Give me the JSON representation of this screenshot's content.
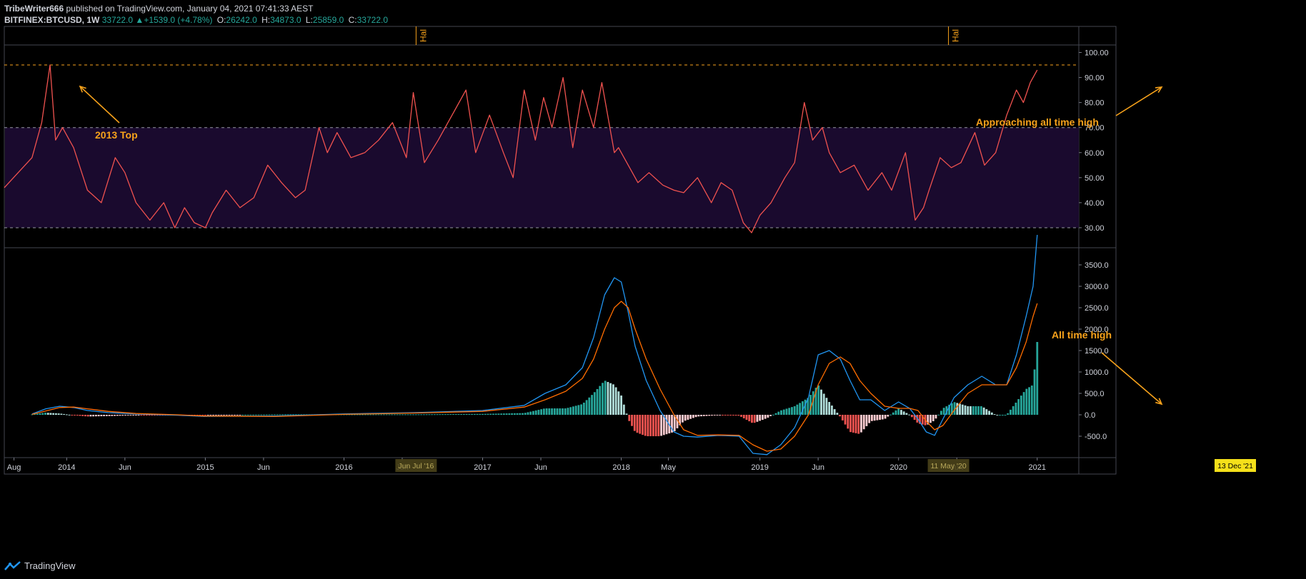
{
  "header": {
    "author": "TribeWriter666",
    "published_text": "published on TradingView.com, January 04, 2021 07:41:33 AEST",
    "symbol": "BITFINEX:BTCUSD, 1W",
    "last": "33722.0",
    "change": "+1539.0 (+4.78%)",
    "open_label": "O:",
    "open": "26242.0",
    "high_label": "H:",
    "high": "34873.0",
    "low_label": "L:",
    "low": "25859.0",
    "close_label": "C:",
    "close": "33722.0"
  },
  "brand": {
    "name": "TradingView"
  },
  "colors": {
    "background": "#000000",
    "rsi_line": "#f0524f",
    "rsi_band": "#1a0a2e",
    "annotation": "#f7a21b",
    "macd_line": "#2196f3",
    "signal_line": "#ff6d00",
    "hist_up_strong": "#26a69a",
    "hist_up_weak": "#b2dfdb",
    "hist_down_strong": "#ef5350",
    "hist_down_weak": "#ffcdd2",
    "date_badge": "#f5e01a"
  },
  "events": {
    "halving_label": "Hal",
    "halvings": [
      {
        "date": "2016.52"
      },
      {
        "date": "2020.36"
      }
    ]
  },
  "x_axis": {
    "range": [
      2013.55,
      2021.3
    ],
    "ticks": [
      {
        "t": 2013.62,
        "label": "Aug"
      },
      {
        "t": 2014.0,
        "label": "2014"
      },
      {
        "t": 2014.42,
        "label": "Jun"
      },
      {
        "t": 2015.0,
        "label": "2015"
      },
      {
        "t": 2015.42,
        "label": "Jun"
      },
      {
        "t": 2016.0,
        "label": "2016"
      },
      {
        "t": 2016.42,
        "label": "Jun"
      },
      {
        "t": 2017.0,
        "label": "2017"
      },
      {
        "t": 2017.42,
        "label": "Jun"
      },
      {
        "t": 2018.0,
        "label": "2018"
      },
      {
        "t": 2018.34,
        "label": "May"
      },
      {
        "t": 2019.0,
        "label": "2019"
      },
      {
        "t": 2019.42,
        "label": "Jun"
      },
      {
        "t": 2020.0,
        "label": "2020"
      },
      {
        "t": 2020.42,
        "label": "Jun"
      },
      {
        "t": 2021.0,
        "label": "2021"
      }
    ],
    "markers": [
      {
        "t": 2016.52,
        "label": "Jun Jul '16"
      },
      {
        "t": 2020.36,
        "label": "11 May '20"
      }
    ],
    "cursor_label": "13 Dec '21"
  },
  "chart_data": [
    {
      "type": "line",
      "name": "RSI",
      "ylim": [
        22,
        103
      ],
      "yticks": [
        30,
        40,
        50,
        60,
        70,
        80,
        90,
        100
      ],
      "ytick_labels": [
        "30.00",
        "40.00",
        "50.00",
        "60.00",
        "70.00",
        "80.00",
        "90.00",
        "100.00"
      ],
      "levels": {
        "oversold": 30,
        "overbought": 70,
        "prior_top": 95
      },
      "x": [
        2013.55,
        2013.65,
        2013.75,
        2013.82,
        2013.88,
        2013.92,
        2013.97,
        2014.05,
        2014.15,
        2014.25,
        2014.35,
        2014.42,
        2014.5,
        2014.6,
        2014.7,
        2014.78,
        2014.85,
        2014.92,
        2015.0,
        2015.05,
        2015.15,
        2015.25,
        2015.35,
        2015.45,
        2015.55,
        2015.65,
        2015.72,
        2015.82,
        2015.88,
        2015.95,
        2016.05,
        2016.15,
        2016.25,
        2016.35,
        2016.45,
        2016.5,
        2016.58,
        2016.68,
        2016.78,
        2016.88,
        2016.95,
        2017.05,
        2017.15,
        2017.22,
        2017.3,
        2017.38,
        2017.44,
        2017.5,
        2017.58,
        2017.65,
        2017.72,
        2017.8,
        2017.86,
        2017.95,
        2017.98,
        2018.05,
        2018.12,
        2018.2,
        2018.3,
        2018.38,
        2018.45,
        2018.55,
        2018.65,
        2018.72,
        2018.8,
        2018.88,
        2018.94,
        2019.0,
        2019.08,
        2019.18,
        2019.25,
        2019.32,
        2019.38,
        2019.45,
        2019.5,
        2019.58,
        2019.68,
        2019.78,
        2019.88,
        2019.95,
        2020.05,
        2020.12,
        2020.18,
        2020.22,
        2020.3,
        2020.38,
        2020.45,
        2020.55,
        2020.62,
        2020.7,
        2020.78,
        2020.85,
        2020.9,
        2020.95,
        2021.0
      ],
      "y": [
        46,
        52,
        58,
        72,
        95,
        65,
        70,
        62,
        45,
        40,
        58,
        52,
        40,
        33,
        40,
        30,
        38,
        32,
        30,
        36,
        45,
        38,
        42,
        55,
        48,
        42,
        45,
        70,
        60,
        68,
        58,
        60,
        65,
        72,
        58,
        84,
        56,
        65,
        75,
        85,
        60,
        75,
        60,
        50,
        85,
        65,
        82,
        70,
        90,
        62,
        85,
        70,
        88,
        60,
        62,
        55,
        48,
        52,
        47,
        45,
        44,
        50,
        40,
        48,
        45,
        32,
        28,
        35,
        40,
        50,
        56,
        80,
        65,
        70,
        60,
        52,
        55,
        45,
        52,
        45,
        60,
        33,
        38,
        45,
        58,
        54,
        56,
        68,
        55,
        60,
        75,
        85,
        80,
        88,
        93
      ]
    },
    {
      "type": "line",
      "name": "MACD",
      "ylim": [
        -1000,
        3900
      ],
      "yticks": [
        -500,
        0,
        500,
        1000,
        1500,
        2000,
        2500,
        3000,
        3500
      ],
      "ytick_labels": [
        "-500.0",
        "0.0",
        "500.0",
        "1000.0",
        "1500.0",
        "2000.0",
        "2500.0",
        "3000.0",
        "3500.0"
      ],
      "x": [
        2013.75,
        2013.85,
        2013.95,
        2014.05,
        2014.15,
        2014.3,
        2014.5,
        2014.8,
        2015.0,
        2015.5,
        2016.0,
        2016.5,
        2017.0,
        2017.3,
        2017.45,
        2017.6,
        2017.72,
        2017.8,
        2017.88,
        2017.95,
        2018.0,
        2018.05,
        2018.1,
        2018.18,
        2018.28,
        2018.38,
        2018.45,
        2018.55,
        2018.7,
        2018.85,
        2018.95,
        2019.05,
        2019.15,
        2019.25,
        2019.35,
        2019.42,
        2019.5,
        2019.58,
        2019.65,
        2019.72,
        2019.8,
        2019.9,
        2020.0,
        2020.08,
        2020.14,
        2020.2,
        2020.26,
        2020.32,
        2020.4,
        2020.5,
        2020.6,
        2020.7,
        2020.78,
        2020.85,
        2020.92,
        2020.97,
        2021.0
      ],
      "series": [
        {
          "name": "MACD",
          "values": [
            20,
            140,
            200,
            170,
            100,
            50,
            20,
            -10,
            -40,
            -30,
            20,
            50,
            100,
            220,
            500,
            700,
            1100,
            1800,
            2800,
            3200,
            3100,
            2400,
            1600,
            800,
            100,
            -400,
            -500,
            -520,
            -480,
            -500,
            -900,
            -930,
            -700,
            -300,
            400,
            1400,
            1500,
            1300,
            800,
            350,
            350,
            100,
            300,
            150,
            -100,
            -400,
            -480,
            -100,
            400,
            700,
            900,
            700,
            700,
            1400,
            2300,
            3000,
            4200
          ]
        },
        {
          "name": "Signal",
          "values": [
            10,
            90,
            170,
            180,
            140,
            80,
            30,
            0,
            -30,
            -40,
            10,
            40,
            80,
            180,
            350,
            550,
            850,
            1300,
            2000,
            2500,
            2650,
            2500,
            2000,
            1300,
            600,
            0,
            -350,
            -480,
            -470,
            -480,
            -700,
            -850,
            -800,
            -500,
            0,
            700,
            1200,
            1350,
            1200,
            800,
            500,
            200,
            150,
            150,
            100,
            -150,
            -350,
            -250,
            100,
            500,
            700,
            700,
            700,
            1100,
            1700,
            2300,
            2600
          ]
        },
        {
          "name": "Histogram",
          "values": [
            10,
            50,
            30,
            -10,
            -40,
            -30,
            -10,
            -10,
            -10,
            10,
            10,
            10,
            20,
            40,
            150,
            150,
            250,
            500,
            800,
            700,
            450,
            -100,
            -400,
            -500,
            -500,
            -400,
            -150,
            -40,
            -10,
            -20,
            -200,
            -80,
            100,
            200,
            400,
            700,
            300,
            -50,
            -400,
            -450,
            -150,
            -100,
            150,
            0,
            -200,
            -250,
            -130,
            150,
            300,
            200,
            200,
            0,
            0,
            300,
            600,
            700,
            1700
          ]
        }
      ]
    }
  ],
  "annotations": [
    {
      "text": "2013 Top",
      "panel": "rsi"
    },
    {
      "text": "Approaching all time high",
      "panel": "rsi"
    },
    {
      "text": "All time high",
      "panel": "macd"
    }
  ]
}
